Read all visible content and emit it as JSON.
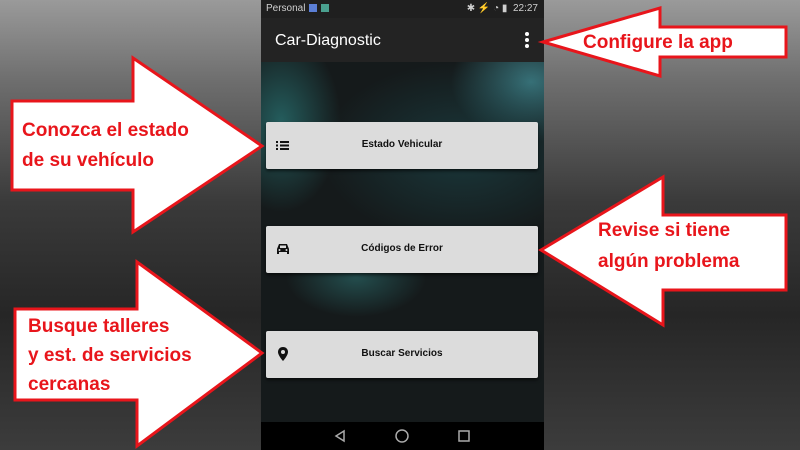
{
  "status_bar": {
    "carrier": "Personal",
    "right_icons": "✱ ⚡ ◔ ▮",
    "time": "22:27"
  },
  "app_bar": {
    "title": "Car-Diagnostic",
    "menu_icon": "more-vert-icon"
  },
  "buttons": [
    {
      "label": "Estado Vehicular",
      "icon": "list-icon"
    },
    {
      "label": "Códigos de Error",
      "icon": "car-icon"
    },
    {
      "label": "Buscar Servicios",
      "icon": "location-pin-icon"
    }
  ],
  "nav_bar": {
    "icons": [
      "back-icon",
      "home-icon",
      "recents-icon"
    ]
  },
  "annotations": {
    "configure": "Configure la app",
    "estado_line1": "Conozca el estado",
    "estado_line2": "de su vehículo",
    "errores_line1": "Revise si tiene",
    "errores_line2": "algún problema",
    "servicios_line1": "Busque talleres",
    "servicios_line2": "y est. de servicios",
    "servicios_line3": "cercanas"
  },
  "colors": {
    "annotation_text": "#e8151b",
    "annotation_arrow_stroke": "#e8151b",
    "arrow_fill": "#ffffff",
    "button": "#dcdcdc",
    "app_bar": "#232323"
  }
}
